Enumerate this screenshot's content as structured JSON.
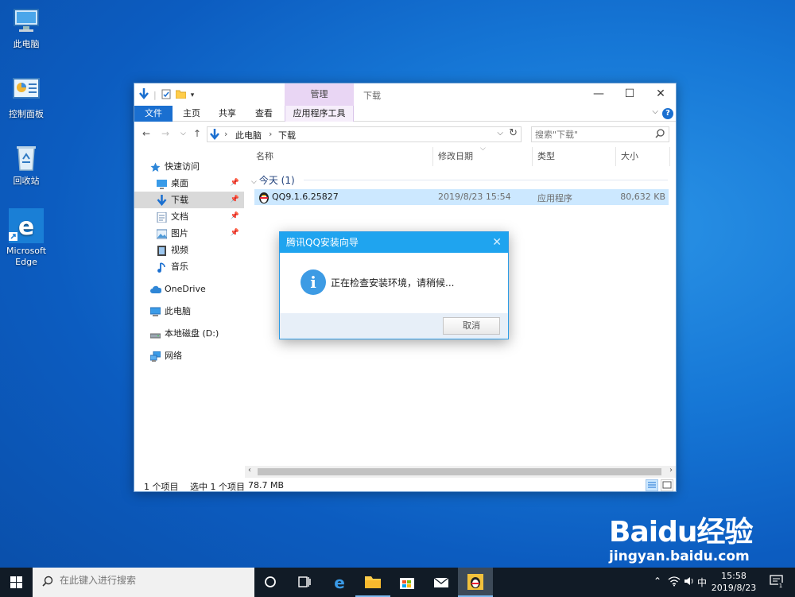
{
  "desktop": {
    "icons": [
      {
        "label": "此电脑"
      },
      {
        "label": "控制面板"
      },
      {
        "label": "回收站"
      },
      {
        "label": "Microsoft Edge"
      }
    ]
  },
  "explorer": {
    "title": "下载",
    "context_tab": "管理",
    "ribbon_tabs": [
      "文件",
      "主页",
      "共享",
      "查看",
      "应用程序工具"
    ],
    "address": [
      "此电脑",
      "下载"
    ],
    "search_placeholder": "搜索\"下载\"",
    "nav": [
      {
        "label": "快速访问"
      },
      {
        "label": "桌面"
      },
      {
        "label": "下载"
      },
      {
        "label": "文档"
      },
      {
        "label": "图片"
      },
      {
        "label": "视频"
      },
      {
        "label": "音乐"
      },
      {
        "label": "OneDrive"
      },
      {
        "label": "此电脑"
      },
      {
        "label": "本地磁盘 (D:)"
      },
      {
        "label": "网络"
      }
    ],
    "columns": [
      "名称",
      "修改日期",
      "类型",
      "大小"
    ],
    "group": "今天 (1)",
    "files": [
      {
        "name": "QQ9.1.6.25827",
        "date": "2019/8/23 15:54",
        "type": "应用程序",
        "size": "80,632 KB"
      }
    ],
    "status": {
      "count": "1 个项目",
      "selected": "选中 1 个项目",
      "size": "78.7 MB"
    }
  },
  "dialog": {
    "title": "腾讯QQ安装向导",
    "message": "正在检查安装环境，请稍候...",
    "cancel": "取消"
  },
  "taskbar": {
    "search_placeholder": "在此键入进行搜索",
    "ime": "中",
    "time": "15:58",
    "date": "2019/8/23"
  },
  "watermark": {
    "logo": "Baidu经验",
    "url": "jingyan.baidu.com"
  },
  "colors": {
    "accent": "#1a6fd0",
    "dialog_title": "#1fa4ef",
    "selection": "#cce8ff"
  }
}
